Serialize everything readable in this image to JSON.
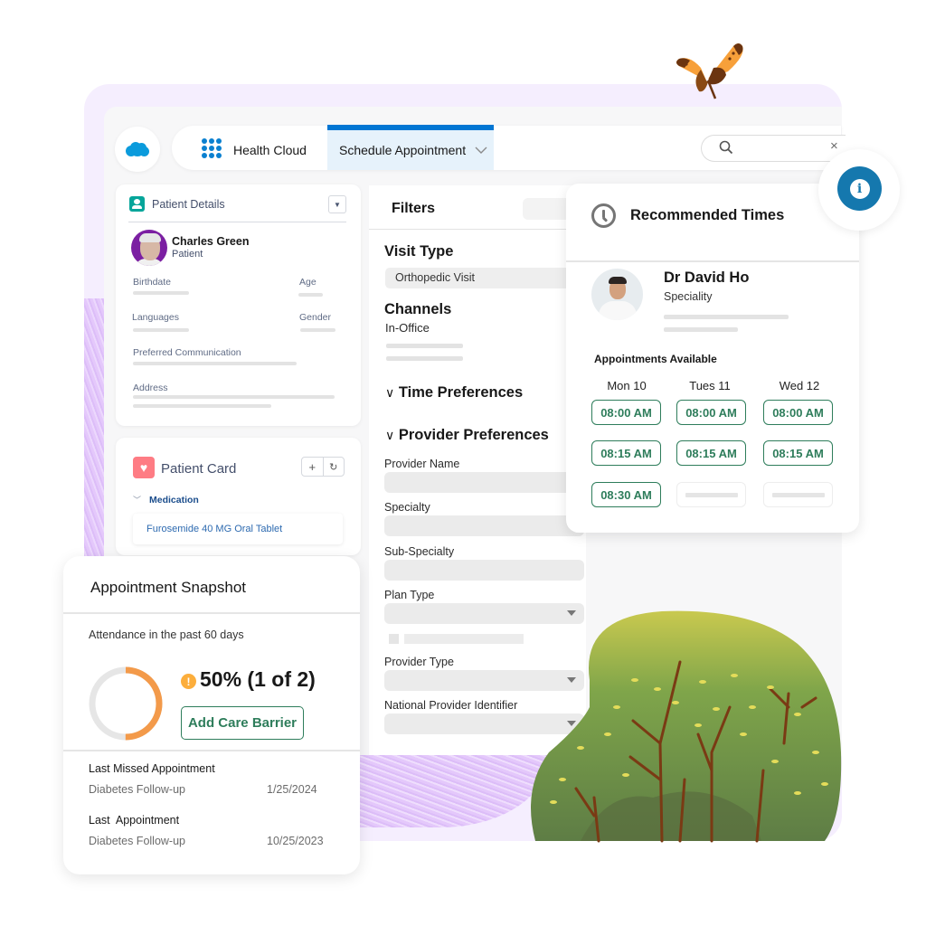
{
  "topbar": {
    "logo": "salesforce-cloud-logo",
    "app_launcher_icon": "app-launcher-grid-icon",
    "app_name": "Health Cloud",
    "active_tab": "Schedule Appointment",
    "search": {
      "placeholder": "",
      "value": ""
    },
    "clear_icon": "×"
  },
  "colors": {
    "brand_blue": "#0176d3",
    "accent_green": "#2e7d5b",
    "warning_orange": "#f39a4a",
    "info_blue": "#1578ae"
  },
  "patient_details": {
    "title": "Patient Details",
    "name": "Charles Green",
    "role": "Patient",
    "fields": [
      "Birthdate",
      "Age",
      "Languages",
      "Gender",
      "Preferred Communication",
      "Address"
    ]
  },
  "patient_card": {
    "title": "Patient Card",
    "add_label": "+",
    "refresh_label": "↻",
    "section": "Medication",
    "items": [
      "Furosemide 40 MG Oral Tablet"
    ]
  },
  "filters": {
    "title": "Filters",
    "visit_type_label": "Visit Type",
    "visit_type_value": "Orthopedic Visit",
    "channels_label": "Channels",
    "channels_value": "In-Office",
    "time_preferences": "Time Preferences",
    "provider_preferences": "Provider Preferences",
    "fields": [
      "Provider Name",
      "Specialty",
      "Sub-Specialty",
      "Plan Type",
      "Provider Type",
      "National Provider Identifier"
    ]
  },
  "recommended_times": {
    "title": "Recommended Times",
    "provider_name": "Dr David Ho",
    "provider_specialty": "Speciality",
    "appointments_label": "Appointments Available",
    "days": [
      "Mon 10",
      "Tues 11",
      "Wed 12"
    ],
    "slots": [
      [
        "08:00 AM",
        "08:15 AM",
        "08:30 AM"
      ],
      [
        "08:00 AM",
        "08:15 AM",
        null
      ],
      [
        "08:00 AM",
        "08:15 AM",
        null
      ]
    ]
  },
  "appointment_snapshot": {
    "title": "Appointment Snapshot",
    "subtitle": "Attendance in the past 60 days",
    "attendance_fraction": 0.5,
    "attendance_text": "50% (1 of 2)",
    "warning_icon": "!",
    "button_label": "Add Care Barrier",
    "last_missed_label": "Last Missed Appointment",
    "last_missed_type": "Diabetes Follow-up",
    "last_missed_date": "1/25/2024",
    "last_label": "Last  Appointment",
    "last_type": "Diabetes Follow-up",
    "last_date": "10/25/2023"
  }
}
